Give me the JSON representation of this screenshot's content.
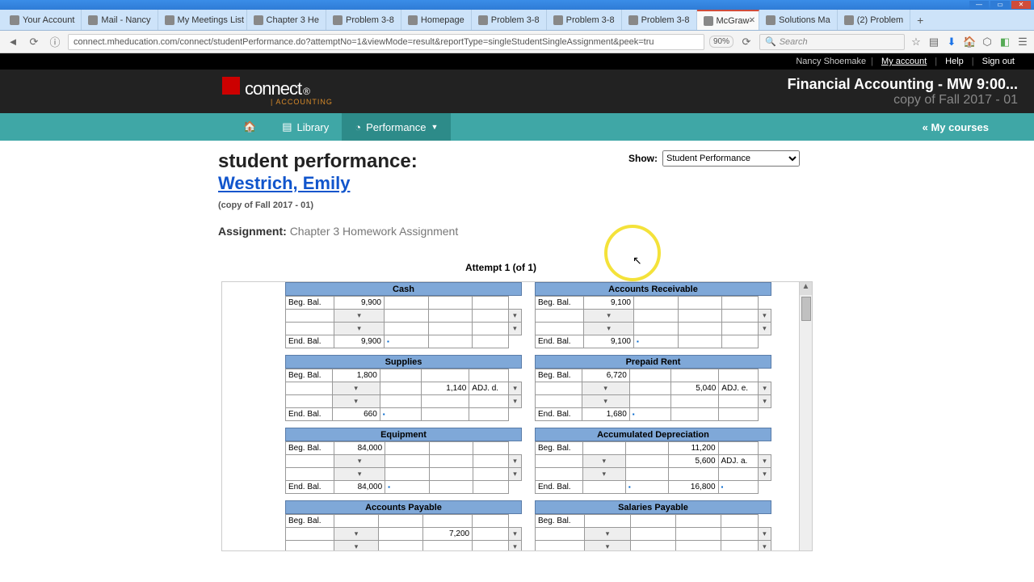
{
  "window": {
    "min": "—",
    "max": "▭",
    "close": "✕"
  },
  "tabs": [
    {
      "label": "Your Account"
    },
    {
      "label": "Mail - Nancy"
    },
    {
      "label": "My Meetings List"
    },
    {
      "label": "Chapter 3 He"
    },
    {
      "label": "Problem 3-8"
    },
    {
      "label": "Homepage"
    },
    {
      "label": "Problem 3-8"
    },
    {
      "label": "Problem 3-8"
    },
    {
      "label": "Problem 3-8"
    },
    {
      "label": "McGraw-",
      "active": true
    },
    {
      "label": "Solutions Ma"
    },
    {
      "label": "(2) Problem"
    }
  ],
  "newtab": "+",
  "url": "connect.mheducation.com/connect/studentPerformance.do?attemptNo=1&viewMode=result&reportType=singleStudentSingleAssignment&peek=tru",
  "zoom": "90%",
  "search_placeholder": "Search",
  "topbar": {
    "user": "Nancy Shoemake",
    "account": "My account",
    "help": "Help",
    "signout": "Sign out"
  },
  "brand": {
    "logo": "connect",
    "sub": "| ACCOUNTING",
    "course": "Financial Accounting - MW 9:00...",
    "section": "copy of Fall 2017 - 01"
  },
  "nav": {
    "library": "Library",
    "performance": "Performance",
    "mycourses": "« My courses"
  },
  "page": {
    "title": "student performance:",
    "student": "Westrich, Emily",
    "copy": "(copy of Fall 2017 - 01)",
    "assign_lbl": "Assignment:",
    "assign_val": "Chapter 3 Homework Assignment",
    "show_lbl": "Show:",
    "show_val": "Student Performance",
    "attempt": "Attempt 1 (of 1)"
  },
  "labels": {
    "beg": "Beg. Bal.",
    "end": "End. Bal."
  },
  "accounts": [
    {
      "name": "Cash",
      "beg": "9,900",
      "end": "9,900",
      "adj_val": "",
      "adj_lbl": ""
    },
    {
      "name": "Accounts Receivable",
      "beg": "9,100",
      "end": "9,100",
      "adj_val": "",
      "adj_lbl": ""
    },
    {
      "name": "Supplies",
      "beg": "1,800",
      "end": "660",
      "adj_val": "1,140",
      "adj_lbl": "ADJ. d."
    },
    {
      "name": "Prepaid Rent",
      "beg": "6,720",
      "end": "1,680",
      "adj_val": "5,040",
      "adj_lbl": "ADJ. e."
    },
    {
      "name": "Equipment",
      "beg": "84,000",
      "end": "84,000",
      "adj_val": "",
      "adj_lbl": ""
    },
    {
      "name": "Accumulated Depreciation",
      "beg": "11,200",
      "end": "16,800",
      "adj_val": "5,600",
      "adj_lbl": "ADJ. a."
    },
    {
      "name": "Accounts Payable",
      "beg": "",
      "end": "",
      "adj_val": "7,200",
      "adj_lbl": ""
    },
    {
      "name": "Salaries Payable",
      "beg": "",
      "end": "",
      "adj_val": "",
      "adj_lbl": ""
    }
  ]
}
